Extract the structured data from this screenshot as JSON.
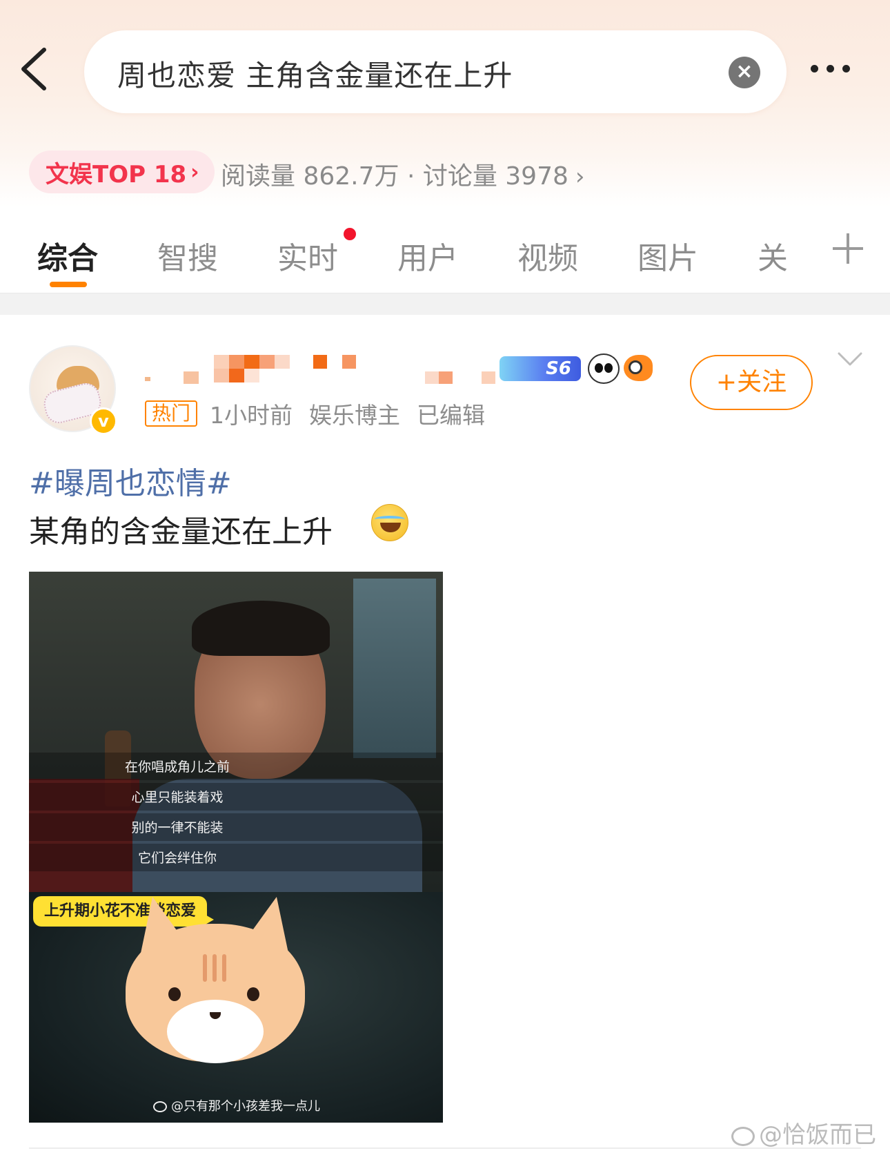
{
  "search": {
    "query": "周也恋爱 主角含金量还在上升"
  },
  "topic_bar": {
    "rank_label": "文娱TOP 18",
    "stats": "阅读量 862.7万 · 讨论量 3978"
  },
  "tabs": [
    {
      "label": "综合"
    },
    {
      "label": "智搜"
    },
    {
      "label": "实时"
    },
    {
      "label": "用户"
    },
    {
      "label": "视频"
    },
    {
      "label": "图片"
    },
    {
      "label": "关"
    }
  ],
  "post": {
    "level_badge": "S6",
    "follow_label": "+关注",
    "hot_tag": "热门",
    "time": "1小时前",
    "author_type": "娱乐博主",
    "edited": "已编辑",
    "hashtag": "#曝周也恋情#",
    "text": "某角的含金量还在上升",
    "image": {
      "subtitles": [
        "在你唱成角儿之前",
        "心里只能装着戏",
        "别的一律不能装",
        "它们会绊住你"
      ],
      "caption_label": "上升期小花不准谈恋爱",
      "watermark": "@只有那个小孩差我一点儿"
    }
  },
  "page_watermark": "@恰饭而已",
  "colors": {
    "accent": "#ff8200",
    "rank_red": "#f2344c",
    "hashtag_blue": "#4f6fa8"
  }
}
